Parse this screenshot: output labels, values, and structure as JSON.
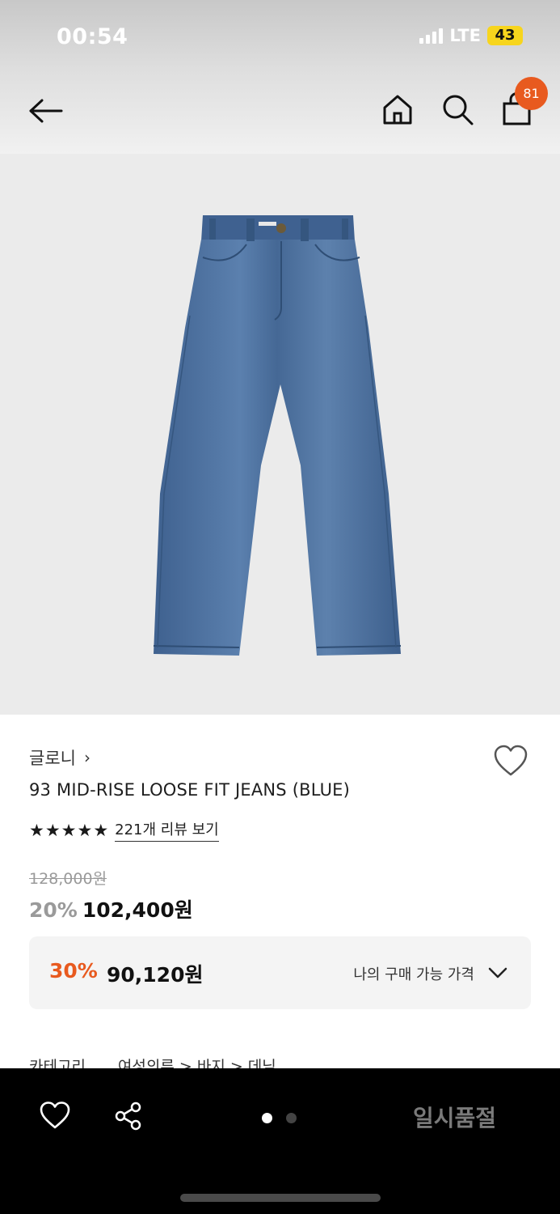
{
  "status_bar": {
    "time": "00:54",
    "network": "LTE",
    "battery": "43"
  },
  "header": {
    "cart_count": "81"
  },
  "product": {
    "brand": "글로니",
    "name": "93 MID-RISE LOOSE FIT JEANS (BLUE)",
    "stars": [
      "★",
      "★",
      "★",
      "★",
      "★"
    ],
    "review_link": "221개 리뷰 보기",
    "original_price": "128,000원",
    "discount_rate": "20%",
    "sale_price": "102,400원"
  },
  "benefit": {
    "rate": "30%",
    "price": "90,120원",
    "label": "나의 구매 가능 가격"
  },
  "category": {
    "label": "카테고리",
    "path": "여성의류 > 바지 > 데님"
  },
  "bottom_bar": {
    "status_button": "일시품절",
    "carousel_active_index": 0,
    "carousel_total": 2
  },
  "colors": {
    "accent": "#e85a1f",
    "image_background": "#ebebeb",
    "denim": "#4a6d9b"
  }
}
